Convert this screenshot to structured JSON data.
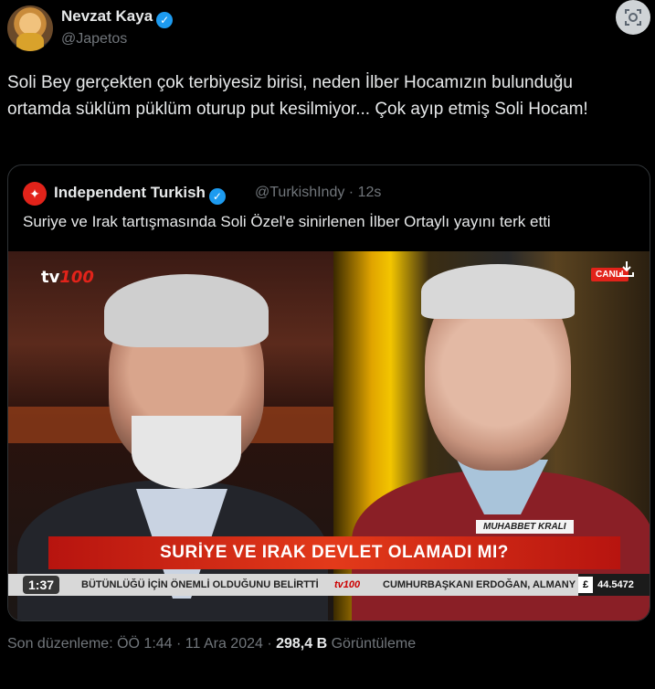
{
  "tweet": {
    "author_name": "Nevzat Kaya",
    "author_handle": "@Japetos",
    "text": "Soli Bey gerçekten çok terbiyesiz birisi, neden İlber Hocamızın bulunduğu ortamda süklüm püklüm oturup put kesilmiyor... Çok ayıp etmiş Soli Hocam!",
    "meta": {
      "edited_label": "Son düzenleme: ÖÖ 1:44 · 11 Ara 2024 ·",
      "views_count": "298,4 B",
      "views_label": "Görüntüleme"
    }
  },
  "quote": {
    "author_name": "Independent Turkish",
    "author_handle": "@TurkishIndy · 12s",
    "text": "Suriye ve Irak tartışmasında Soli Özel'e sinirlenen İlber Ortaylı yayını terk etti",
    "video": {
      "channel_prefix": "tv",
      "channel_number": "100",
      "live_badge": "CANLI",
      "program_name": "MUHABBET KRALI",
      "headline": "SURİYE VE IRAK DEVLET OLAMADI MI?",
      "ticker_left": "BÜTÜNLÜĞÜ İÇİN ÖNEMLİ OLDUĞUNU BELİRTTİ",
      "ticker_logo": "tv100",
      "ticker_right": "CUMHURBAŞKANI ERDOĞAN, ALMANY",
      "currency_symbol": "£",
      "currency_value": "44.5472",
      "duration": "1:37"
    }
  },
  "icons": {
    "verified": "verified-badge-icon",
    "lens": "image-search-icon",
    "download": "download-icon",
    "quote_logo": "independent-eagle-icon"
  },
  "colors": {
    "background": "#000000",
    "text": "#e7e9ea",
    "muted": "#71767b",
    "verified": "#1d9bf0",
    "brand_red": "#e2231a"
  }
}
